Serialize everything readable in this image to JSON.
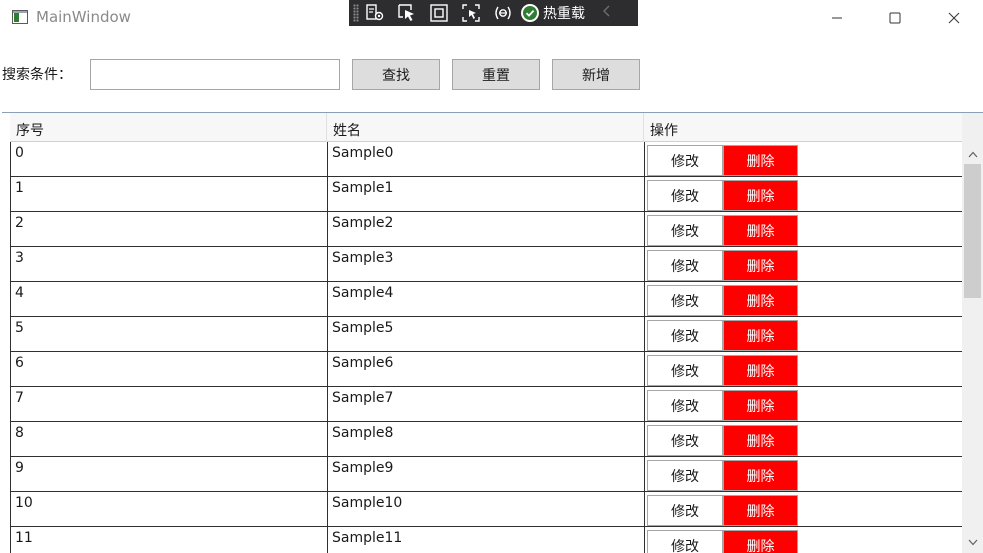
{
  "window": {
    "title": "MainWindow",
    "controls": {
      "minimize": "minimize-icon",
      "maximize": "maximize-icon",
      "close": "close-icon"
    }
  },
  "debug_toolbar": {
    "tools": [
      "live-visual-tree-icon",
      "select-element-icon",
      "display-adorners-icon",
      "track-focus-icon",
      "binding-failures-icon"
    ],
    "hot_reload_label": "热重载",
    "status_color": "#2e7d32"
  },
  "search": {
    "label": "搜索条件：",
    "value": "",
    "placeholder": "",
    "find_label": "查找",
    "reset_label": "重置",
    "add_label": "新增"
  },
  "table": {
    "columns": [
      "序号",
      "姓名",
      "操作"
    ],
    "edit_label": "修改",
    "delete_label": "删除",
    "delete_color": "#ff0000",
    "rows": [
      {
        "id": "0",
        "name": "Sample0"
      },
      {
        "id": "1",
        "name": "Sample1"
      },
      {
        "id": "2",
        "name": "Sample2"
      },
      {
        "id": "3",
        "name": "Sample3"
      },
      {
        "id": "4",
        "name": "Sample4"
      },
      {
        "id": "5",
        "name": "Sample5"
      },
      {
        "id": "6",
        "name": "Sample6"
      },
      {
        "id": "7",
        "name": "Sample7"
      },
      {
        "id": "8",
        "name": "Sample8"
      },
      {
        "id": "9",
        "name": "Sample9"
      },
      {
        "id": "10",
        "name": "Sample10"
      },
      {
        "id": "11",
        "name": "Sample11"
      }
    ]
  }
}
